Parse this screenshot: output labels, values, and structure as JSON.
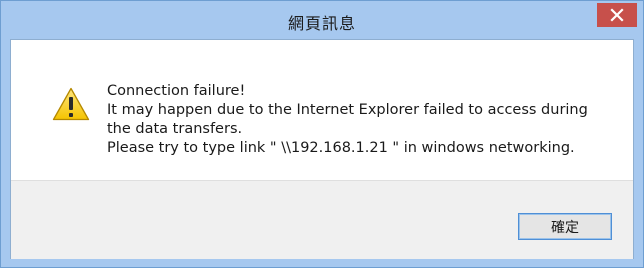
{
  "window": {
    "title": "網頁訊息",
    "close_label": "×"
  },
  "icon": "warning-icon",
  "message": {
    "line1": "Connection failure!",
    "line2": "It may happen due to the Internet Explorer failed to access during",
    "line3": "the data transfers.",
    "line4": "Please try to type link \" \\\\192.168.1.21 \" in windows networking."
  },
  "buttons": {
    "ok_label": "確定"
  },
  "colors": {
    "frame": "#a6c8ef",
    "close": "#c7504b",
    "footer": "#f0f0f0"
  }
}
